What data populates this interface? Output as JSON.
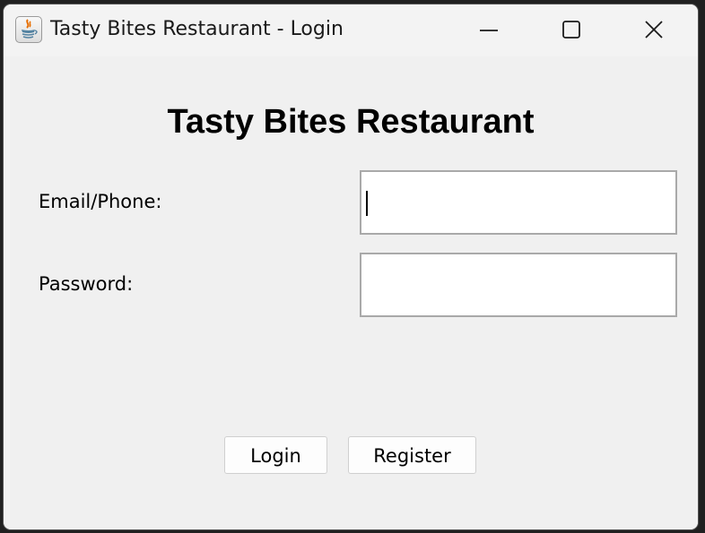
{
  "window": {
    "title": "Tasty Bites Restaurant - Login",
    "app_icon": "java-coffee-cup-icon",
    "controls": {
      "minimize_icon": "minimize-icon",
      "maximize_icon": "maximize-icon",
      "close_icon": "close-icon"
    }
  },
  "form": {
    "heading": "Tasty Bites Restaurant",
    "email_label": "Email/Phone:",
    "email_value": "",
    "password_label": "Password:",
    "password_value": "",
    "login_label": "Login",
    "register_label": "Register"
  },
  "colors": {
    "background": "#f0f0f0",
    "input_border": "#a9a9a9",
    "java_icon_orange": "#e76f00",
    "java_icon_blue": "#5382a1"
  }
}
